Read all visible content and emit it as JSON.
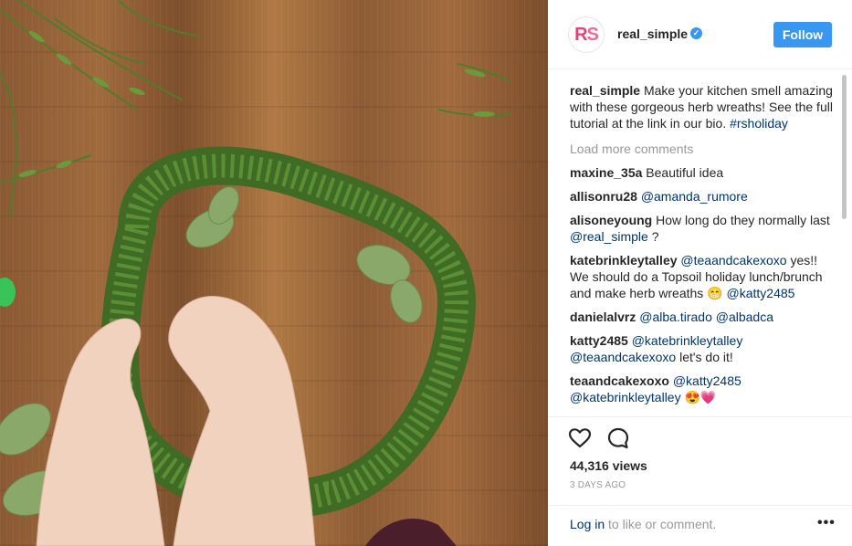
{
  "header": {
    "avatar_letters_r": "R",
    "avatar_letters_s": "S",
    "username": "real_simple",
    "verified_mark": "✓",
    "follow_label": "Follow"
  },
  "caption": {
    "user": "real_simple",
    "text": "Make your kitchen smell amazing with these gorgeous herb wreaths! See the full tutorial at the link in our bio.",
    "hashtag": "#rsholiday"
  },
  "load_more": "Load more comments",
  "comments": [
    {
      "user": "maxine_35a",
      "pre": "Beautiful idea",
      "mentions": [],
      "post": ""
    },
    {
      "user": "allisonru28",
      "pre": "",
      "mentions": [
        "@amanda_rumore"
      ],
      "post": ""
    },
    {
      "user": "alisoneyoung",
      "pre": "How long do they normally last",
      "mentions": [
        "@real_simple"
      ],
      "post": "?"
    },
    {
      "user": "katebrinkleytalley",
      "pre": "",
      "mentions": [
        "@teaandcakexoxo"
      ],
      "post": "yes!! We should do a Topsoil holiday lunch/brunch and make herb wreaths 😁",
      "tail_mention": "@katty2485"
    },
    {
      "user": "danielalvrz",
      "pre": "",
      "mentions": [
        "@alba.tirado",
        "@albadca"
      ],
      "post": ""
    },
    {
      "user": "katty2485",
      "pre": "",
      "mentions": [
        "@katebrinkleytalley",
        "@teaandcakexoxo"
      ],
      "post": "let's do it!"
    },
    {
      "user": "teaandcakexoxo",
      "pre": "",
      "mentions": [
        "@katty2485",
        "@katebrinkleytalley"
      ],
      "post": "😍💗"
    }
  ],
  "actions": {
    "heart_icon": "heart-outline",
    "comment_icon": "comment-bubble",
    "views": "44,316 views",
    "date": "3 DAYS AGO"
  },
  "footer": {
    "login_link": "Log in",
    "login_rest": "to like or comment.",
    "more": "•••"
  },
  "colors": {
    "accent": "#3897f0",
    "link": "#003569",
    "muted": "#999999",
    "brand_pink": "#e8417a"
  }
}
